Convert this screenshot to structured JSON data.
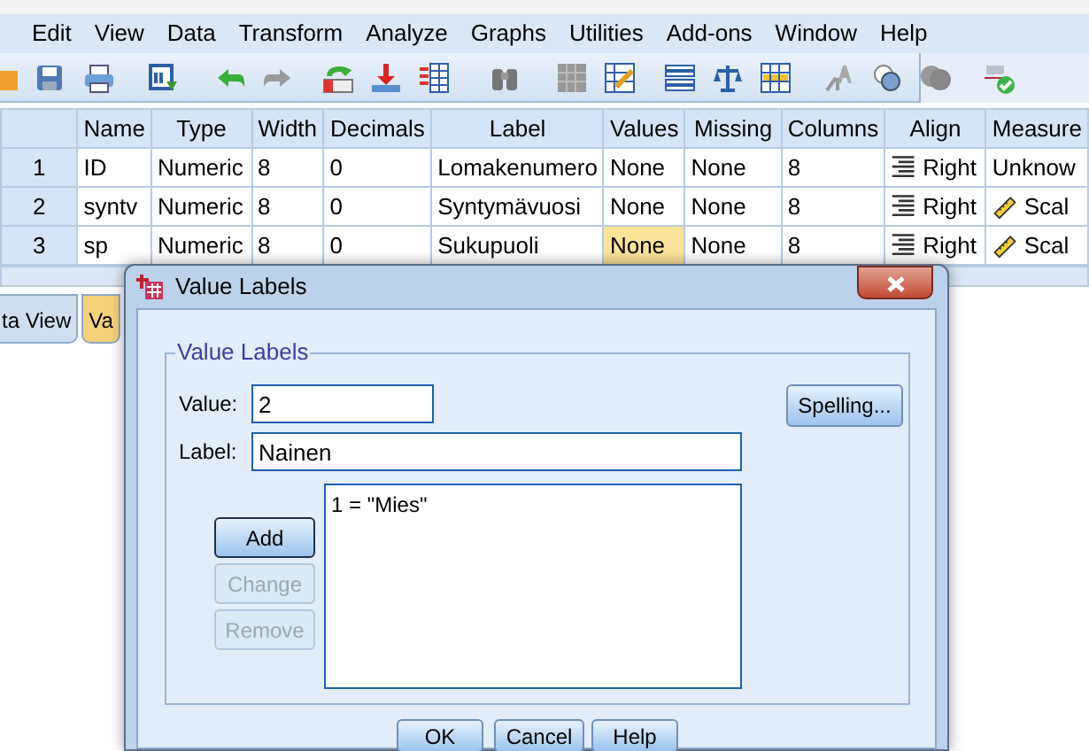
{
  "menu": [
    "Edit",
    "View",
    "Data",
    "Transform",
    "Analyze",
    "Graphs",
    "Utilities",
    "Add-ons",
    "Window",
    "Help"
  ],
  "grid": {
    "columns": [
      "Name",
      "Type",
      "Width",
      "Decimals",
      "Label",
      "Values",
      "Missing",
      "Columns",
      "Align",
      "Measure"
    ],
    "rows": [
      {
        "number": "1",
        "cells": [
          {
            "text": "ID",
            "kind": "text",
            "selected": false
          },
          {
            "text": "Numeric",
            "kind": "text",
            "selected": false
          },
          {
            "text": "8",
            "kind": "text",
            "selected": false
          },
          {
            "text": "0",
            "kind": "text",
            "selected": false
          },
          {
            "text": "Lomakenumero",
            "kind": "text",
            "selected": false
          },
          {
            "text": "None",
            "kind": "text",
            "selected": false
          },
          {
            "text": "None",
            "kind": "text",
            "selected": false
          },
          {
            "text": "8",
            "kind": "text",
            "selected": false
          },
          {
            "text": "Right",
            "kind": "align",
            "selected": false
          },
          {
            "text": "Unknow",
            "kind": "text",
            "selected": false
          }
        ]
      },
      {
        "number": "2",
        "cells": [
          {
            "text": "syntv",
            "kind": "text",
            "selected": false
          },
          {
            "text": "Numeric",
            "kind": "text",
            "selected": false
          },
          {
            "text": "8",
            "kind": "text",
            "selected": false
          },
          {
            "text": "0",
            "kind": "text",
            "selected": false
          },
          {
            "text": "Syntymävuosi",
            "kind": "text",
            "selected": false
          },
          {
            "text": "None",
            "kind": "text",
            "selected": false
          },
          {
            "text": "None",
            "kind": "text",
            "selected": false
          },
          {
            "text": "8",
            "kind": "text",
            "selected": false
          },
          {
            "text": "Right",
            "kind": "align",
            "selected": false
          },
          {
            "text": "Scal",
            "kind": "scale",
            "selected": false
          }
        ]
      },
      {
        "number": "3",
        "cells": [
          {
            "text": "sp",
            "kind": "text",
            "selected": false
          },
          {
            "text": "Numeric",
            "kind": "text",
            "selected": false
          },
          {
            "text": "8",
            "kind": "text",
            "selected": false
          },
          {
            "text": "0",
            "kind": "text",
            "selected": false
          },
          {
            "text": "Sukupuoli",
            "kind": "text",
            "selected": false
          },
          {
            "text": "None",
            "kind": "text",
            "selected": true
          },
          {
            "text": "None",
            "kind": "text",
            "selected": false
          },
          {
            "text": "8",
            "kind": "text",
            "selected": false
          },
          {
            "text": "Right",
            "kind": "align",
            "selected": false
          },
          {
            "text": "Scal",
            "kind": "scale",
            "selected": false
          }
        ]
      }
    ]
  },
  "tabs": [
    {
      "label": "ta View",
      "selected": false
    },
    {
      "label": "Va",
      "selected": true
    }
  ],
  "dialog": {
    "title": "Value Labels",
    "group_title": "Value Labels",
    "value_field": {
      "label": "Value:",
      "value": "2"
    },
    "label_field": {
      "label": "Label:",
      "value": "Nainen"
    },
    "spelling_button": "Spelling...",
    "side_buttons": [
      {
        "label": "Add",
        "disabled": false
      },
      {
        "label": "Change",
        "disabled": true
      },
      {
        "label": "Remove",
        "disabled": true
      }
    ],
    "list_items": [
      "1 = \"Mies\""
    ],
    "bottom_buttons": [
      "OK",
      "Cancel",
      "Help"
    ]
  }
}
